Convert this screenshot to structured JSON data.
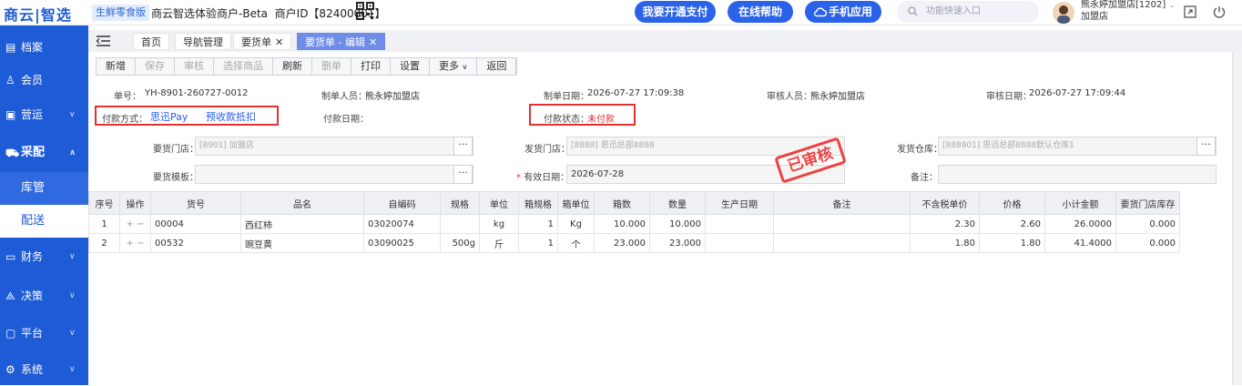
{
  "app": {
    "logo": "商云|智选",
    "edition": "生鲜零食版",
    "merchant": "商云智选体验商户-Beta",
    "merchant_id": "商户ID【82400001】"
  },
  "header": {
    "btn_pay": "我要开通支付",
    "btn_help": "在线帮助",
    "btn_mobile": "手机应用",
    "search_placeholder": "功能快速入口",
    "user_name": "熊永婷加盟店[1202]",
    "user_role": "加盟店"
  },
  "sidebar": {
    "items": [
      {
        "label": "档案",
        "icon": "doc-icon"
      },
      {
        "label": "会员",
        "icon": "user-icon"
      },
      {
        "label": "营运",
        "icon": "shop-icon"
      },
      {
        "label": "采配",
        "icon": "truck-icon"
      },
      {
        "label": "库管"
      },
      {
        "label": "配送"
      },
      {
        "label": "财务",
        "icon": "money-icon"
      },
      {
        "label": "决策",
        "icon": "chart-icon"
      },
      {
        "label": "平台",
        "icon": "platform-icon"
      },
      {
        "label": "系统",
        "icon": "gear-icon"
      }
    ]
  },
  "tabs": [
    "首页",
    "导航管理",
    "要货单",
    "要货单 - 编辑"
  ],
  "toolbar": [
    "新增",
    "保存",
    "审核",
    "选择商品",
    "刷新",
    "删单",
    "打印",
    "设置",
    "更多",
    "返回"
  ],
  "form": {
    "order_no_label": "单号：",
    "order_no": "YH-8901-260727-0012",
    "creator_label": "制单人员：",
    "creator": "熊永婷加盟店",
    "create_date_label": "制单日期：",
    "create_date": "2026-07-27 17:09:38",
    "auditor_label": "审核人员：",
    "auditor": "熊永婷加盟店",
    "audit_date_label": "审核日期：",
    "audit_date": "2026-07-27 17:09:44",
    "pay_method_label": "付款方式：",
    "pay_method_1": "思迅Pay",
    "pay_method_2": "预收款抵扣",
    "pay_date_label": "付款日期：",
    "pay_status_label": "付款状态：",
    "pay_status": "未付款",
    "req_store_label": "要货门店：",
    "req_store": "[8901]  加盟店",
    "ship_store_label": "发货门店：",
    "ship_store": "[8888]  思迅总部8888",
    "ship_wh_label": "发货仓库：",
    "ship_wh": "[888801]  思迅总部8888默认仓库1",
    "template_label": "要货模板：",
    "valid_date_label": "有效日期：",
    "valid_date": "2026-07-28",
    "remark_label": "备注：",
    "stamp": "已审核"
  },
  "table": {
    "headers": [
      "序号",
      "操作",
      "货号",
      "品名",
      "自编码",
      "规格",
      "单位",
      "箱规格",
      "箱单位",
      "箱数",
      "数量",
      "生产日期",
      "备注",
      "不含税单价",
      "价格",
      "小计金额",
      "要货门店库存"
    ],
    "rows": [
      {
        "no": "1",
        "op": "+ −",
        "code": "00004",
        "name": "西红柿",
        "self_code": "03020074",
        "spec": "",
        "unit": "kg",
        "box_spec": "1",
        "box_unit": "Kg",
        "boxes": "10.000",
        "qty": "10.000",
        "prod_date": "",
        "remark": "",
        "price_ex": "2.30",
        "price": "2.60",
        "subtotal": "26.0000",
        "stock": "0.000"
      },
      {
        "no": "2",
        "op": "+ −",
        "code": "00532",
        "name": "豌豆黄",
        "self_code": "03090025",
        "spec": "500g",
        "unit": "斤",
        "box_spec": "1",
        "box_unit": "个",
        "boxes": "23.000",
        "qty": "23.000",
        "prod_date": "",
        "remark": "",
        "price_ex": "1.80",
        "price": "1.80",
        "subtotal": "41.4000",
        "stock": "0.000"
      }
    ]
  }
}
